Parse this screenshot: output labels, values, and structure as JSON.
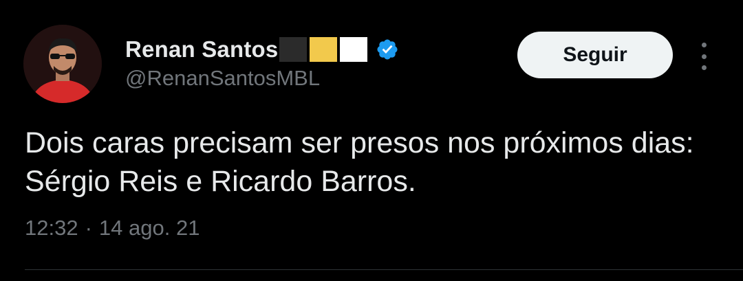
{
  "colors": {
    "background": "#000000",
    "text_primary": "#e7e9ea",
    "text_secondary": "#71767b",
    "verified_blue": "#1d9bf0",
    "button_bg": "#eff3f4",
    "button_text": "#0f1419",
    "flag_colors": [
      "#2b2b2b",
      "#f2c94c",
      "#ffffff"
    ]
  },
  "author": {
    "display_name": "Renan Santos",
    "handle": "@RenanSantosMBL",
    "verified_icon": "verified-badge-icon",
    "flag_emoji_icon": "flag-emoji-icon"
  },
  "actions": {
    "follow_label": "Seguir",
    "more_icon": "more-vertical-icon"
  },
  "tweet": {
    "text": "Dois caras precisam ser presos nos próximos dias: Sérgio Reis e Ricardo Barros.",
    "time": "12:32",
    "separator": "·",
    "date": "14 ago. 21"
  }
}
